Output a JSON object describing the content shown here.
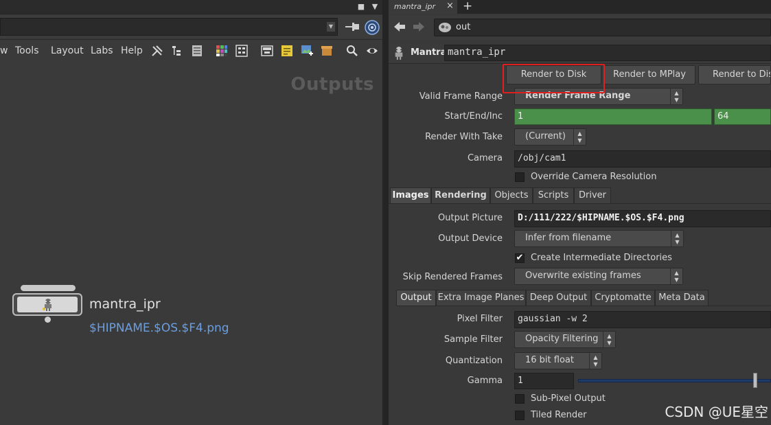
{
  "left": {
    "titlebar": {
      "square_glyph": "■",
      "arrow_glyph": "▼"
    },
    "path_combo_arrow": "▼",
    "menu": [
      "w",
      "Tools",
      "Layout",
      "Labs",
      "Help"
    ],
    "icons": [
      "pin-icon",
      "network-target-icon",
      "wrench-icon",
      "tree-icon",
      "list-icon",
      "color-palette-icon",
      "grid-icon",
      "layout-icon",
      "note-icon",
      "image-add-icon",
      "box-icon",
      "search-icon",
      "eye-icon"
    ],
    "context_label": "Outputs",
    "node": {
      "name": "mantra_ipr",
      "output_label": "$HIPNAME.$OS.$F4.png"
    }
  },
  "right": {
    "tab_label": "mantra_ipr",
    "tab_close": "×",
    "tab_add": "+",
    "path": "out",
    "node_type": "Mantra",
    "node_name": "mantra_ipr",
    "buttons": {
      "render_disk": "Render to Disk",
      "render_mplay": "Render to MPlay",
      "render_disk_2": "Render to Disk"
    },
    "params": {
      "valid_frame_range_label": "Valid Frame Range",
      "valid_frame_range_value": "Render Frame Range",
      "start_end_label": "Start/End/Inc",
      "start_value": "1",
      "end_value": "64",
      "take_label": "Render With Take",
      "take_value": "(Current)",
      "camera_label": "Camera",
      "camera_value": "/obj/cam1",
      "override_res_label": "Override Camera Resolution"
    },
    "tabs": [
      "Images",
      "Rendering",
      "Objects",
      "Scripts",
      "Driver"
    ],
    "images": {
      "output_picture_label": "Output Picture",
      "output_picture_value": "D:/111/222/$HIPNAME.$OS.$F4.png",
      "output_device_label": "Output Device",
      "output_device_value": "Infer from filename",
      "create_dirs_label": "Create Intermediate Directories",
      "create_dirs_check": "✔",
      "skip_frames_label": "Skip Rendered Frames",
      "skip_frames_value": "Overwrite existing frames"
    },
    "subtabs": [
      "Output",
      "Extra Image Planes",
      "Deep Output",
      "Cryptomatte",
      "Meta Data"
    ],
    "output": {
      "pixel_filter_label": "Pixel Filter",
      "pixel_filter_value": "gaussian -w 2",
      "sample_filter_label": "Sample Filter",
      "sample_filter_value": "Opacity Filtering",
      "quantization_label": "Quantization",
      "quantization_value": "16 bit float",
      "gamma_label": "Gamma",
      "gamma_value": "1",
      "subpixel_label": "Sub-Pixel Output",
      "tiled_label": "Tiled Render"
    },
    "updown_glyph": "▲\n▼",
    "watermark": "CSDN @UE星空"
  },
  "colors": {
    "highlight": "#e02020",
    "green_field": "#4a8f4a",
    "link_blue": "#6b9fe0"
  }
}
